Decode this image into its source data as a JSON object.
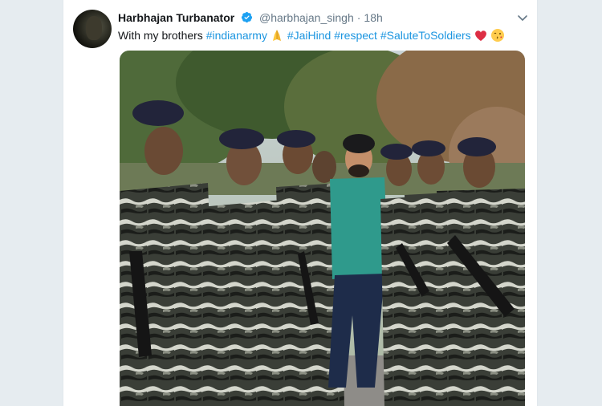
{
  "tweet": {
    "display_name": "Harbhajan Turbanator",
    "handle": "@harbhajan_singh",
    "separator": "·",
    "time": "18h",
    "text_prefix": "With my brothers",
    "hashtags": [
      "#indianarmy",
      "#JaiHind",
      "#respect",
      "#SaluteToSoldiers"
    ]
  },
  "icons": {
    "verified": "verified-badge-icon",
    "caret": "chevron-down-icon",
    "emoji_1": "folded-hands-emoji",
    "emoji_2": "red-heart-emoji",
    "emoji_3": "face-blowing-kiss-emoji"
  },
  "colors": {
    "accent": "#1b95e0",
    "text": "#14171a",
    "secondary": "#657786",
    "background": "#e6ecf0"
  }
}
